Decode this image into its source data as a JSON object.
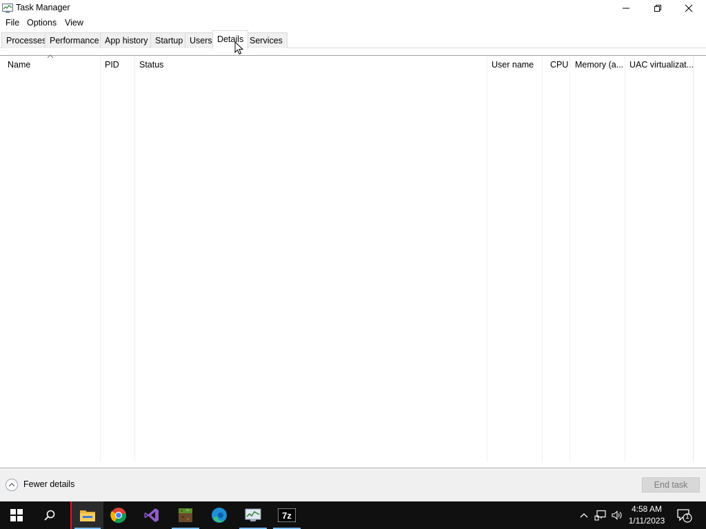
{
  "window": {
    "title": "Task Manager",
    "icon": "task-manager-icon"
  },
  "menu": [
    "File",
    "Options",
    "View"
  ],
  "tabs": [
    {
      "label": "Processes",
      "active": false
    },
    {
      "label": "Performance",
      "active": false
    },
    {
      "label": "App history",
      "active": false
    },
    {
      "label": "Startup",
      "active": false
    },
    {
      "label": "Users",
      "active": false
    },
    {
      "label": "Details",
      "active": true
    },
    {
      "label": "Services",
      "active": false
    }
  ],
  "details": {
    "sorted_column": "Name",
    "columns": [
      "Name",
      "PID",
      "Status",
      "User name",
      "CPU",
      "Memory (a...",
      "UAC virtualizat..."
    ],
    "rows": []
  },
  "footer": {
    "fewer_details_label": "Fewer details",
    "end_task_label": "End task",
    "end_task_enabled": false
  },
  "taskbar": {
    "items": [
      "start",
      "search",
      "file-explorer",
      "chrome",
      "visual-studio",
      "minecraft",
      "edge",
      "task-manager",
      "7zip"
    ],
    "clock_time": "4:58 AM",
    "clock_date": "1/11/2023",
    "notification_count": "1",
    "colors": {
      "background": "#101010",
      "accent": "#76b9ed"
    }
  }
}
